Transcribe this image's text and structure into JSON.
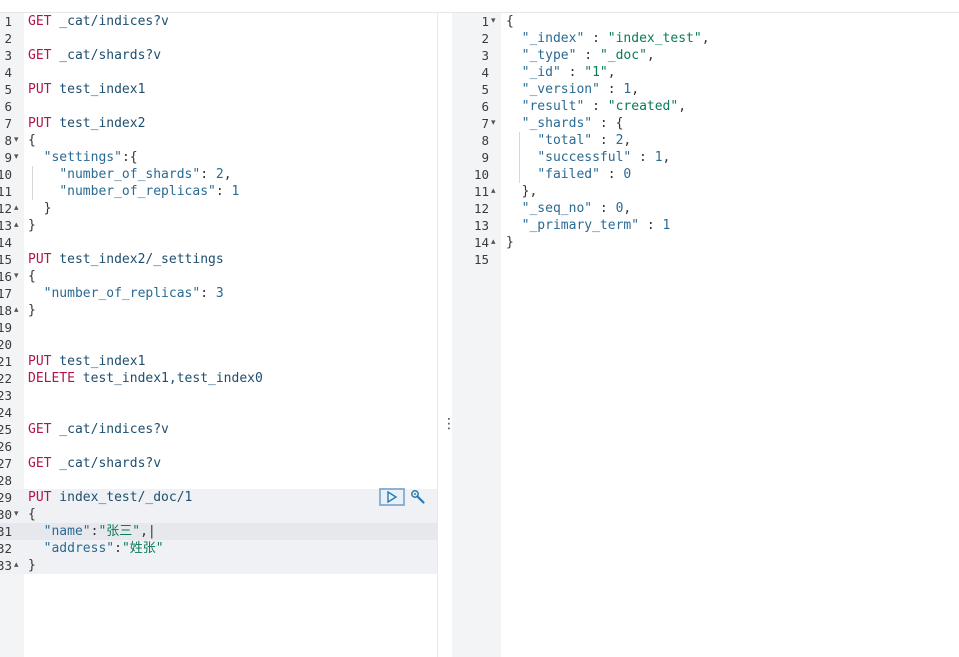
{
  "request": {
    "lines": [
      {
        "n": "1",
        "t": [
          [
            "m",
            "GET"
          ],
          [
            "u",
            " _cat/indices?v"
          ]
        ]
      },
      {
        "n": "2",
        "t": []
      },
      {
        "n": "3",
        "t": [
          [
            "m",
            "GET"
          ],
          [
            "u",
            " _cat/shards?v"
          ]
        ]
      },
      {
        "n": "4",
        "t": []
      },
      {
        "n": "5",
        "t": [
          [
            "m",
            "PUT"
          ],
          [
            "u",
            " test_index1"
          ]
        ]
      },
      {
        "n": "6",
        "t": []
      },
      {
        "n": "7",
        "t": [
          [
            "m",
            "PUT"
          ],
          [
            "u",
            " test_index2"
          ]
        ]
      },
      {
        "n": "8",
        "f": "▾",
        "t": [
          [
            "p",
            "{"
          ]
        ]
      },
      {
        "n": "9",
        "f": "▾",
        "t": [
          [
            "p",
            "  "
          ],
          [
            "k",
            "\"settings\""
          ],
          [
            "p",
            ":{"
          ]
        ]
      },
      {
        "n": "10",
        "t": [
          [
            "p",
            "    "
          ],
          [
            "k",
            "\"number_of_shards\""
          ],
          [
            "p",
            ": "
          ],
          [
            "n",
            "2"
          ],
          [
            "p",
            ","
          ]
        ]
      },
      {
        "n": "11",
        "t": [
          [
            "p",
            "    "
          ],
          [
            "k",
            "\"number_of_replicas\""
          ],
          [
            "p",
            ": "
          ],
          [
            "n",
            "1"
          ]
        ]
      },
      {
        "n": "12",
        "f": "▴",
        "t": [
          [
            "p",
            "  }"
          ]
        ]
      },
      {
        "n": "13",
        "f": "▴",
        "t": [
          [
            "p",
            "}"
          ]
        ]
      },
      {
        "n": "14",
        "t": []
      },
      {
        "n": "15",
        "t": [
          [
            "m",
            "PUT"
          ],
          [
            "u",
            " test_index2/_settings"
          ]
        ]
      },
      {
        "n": "16",
        "f": "▾",
        "t": [
          [
            "p",
            "{"
          ]
        ]
      },
      {
        "n": "17",
        "t": [
          [
            "p",
            "  "
          ],
          [
            "k",
            "\"number_of_replicas\""
          ],
          [
            "p",
            ": "
          ],
          [
            "n",
            "3"
          ]
        ]
      },
      {
        "n": "18",
        "f": "▴",
        "t": [
          [
            "p",
            "}"
          ]
        ]
      },
      {
        "n": "19",
        "t": []
      },
      {
        "n": "20",
        "t": []
      },
      {
        "n": "21",
        "t": [
          [
            "m",
            "PUT"
          ],
          [
            "u",
            " test_index1"
          ]
        ]
      },
      {
        "n": "22",
        "t": [
          [
            "m",
            "DELETE"
          ],
          [
            "u",
            " test_index1,test_index0"
          ]
        ]
      },
      {
        "n": "23",
        "t": []
      },
      {
        "n": "24",
        "t": []
      },
      {
        "n": "25",
        "t": [
          [
            "m",
            "GET"
          ],
          [
            "u",
            " _cat/indices?v"
          ]
        ]
      },
      {
        "n": "26",
        "t": []
      },
      {
        "n": "27",
        "t": [
          [
            "m",
            "GET"
          ],
          [
            "u",
            " _cat/shards?v"
          ]
        ]
      },
      {
        "n": "28",
        "t": []
      },
      {
        "n": "29",
        "sel": true,
        "t": [
          [
            "m",
            "PUT"
          ],
          [
            "u",
            " index_test/_doc/1"
          ]
        ]
      },
      {
        "n": "30",
        "f": "▾",
        "sel": true,
        "t": [
          [
            "p",
            "{"
          ]
        ]
      },
      {
        "n": "31",
        "sel": true,
        "cur": true,
        "t": [
          [
            "p",
            "  "
          ],
          [
            "k",
            "\"name\""
          ],
          [
            "p",
            ":"
          ],
          [
            "s",
            "\"张三\""
          ],
          [
            "p",
            ",|"
          ]
        ]
      },
      {
        "n": "32",
        "sel": true,
        "t": [
          [
            "p",
            "  "
          ],
          [
            "k",
            "\"address\""
          ],
          [
            "p",
            ":"
          ],
          [
            "s",
            "\"姓张\""
          ]
        ]
      },
      {
        "n": "33",
        "f": "▴",
        "sel": true,
        "t": [
          [
            "p",
            "}"
          ]
        ]
      }
    ]
  },
  "response": {
    "lines": [
      {
        "n": "1",
        "f": "▾",
        "t": [
          [
            "p",
            "{"
          ]
        ]
      },
      {
        "n": "2",
        "t": [
          [
            "p",
            "  "
          ],
          [
            "k",
            "\"_index\""
          ],
          [
            "p",
            " : "
          ],
          [
            "s",
            "\"index_test\""
          ],
          [
            "p",
            ","
          ]
        ]
      },
      {
        "n": "3",
        "t": [
          [
            "p",
            "  "
          ],
          [
            "k",
            "\"_type\""
          ],
          [
            "p",
            " : "
          ],
          [
            "s",
            "\"_doc\""
          ],
          [
            "p",
            ","
          ]
        ]
      },
      {
        "n": "4",
        "t": [
          [
            "p",
            "  "
          ],
          [
            "k",
            "\"_id\""
          ],
          [
            "p",
            " : "
          ],
          [
            "s",
            "\"1\""
          ],
          [
            "p",
            ","
          ]
        ]
      },
      {
        "n": "5",
        "t": [
          [
            "p",
            "  "
          ],
          [
            "k",
            "\"_version\""
          ],
          [
            "p",
            " : "
          ],
          [
            "n",
            "1"
          ],
          [
            "p",
            ","
          ]
        ]
      },
      {
        "n": "6",
        "t": [
          [
            "p",
            "  "
          ],
          [
            "k",
            "\"result\""
          ],
          [
            "p",
            " : "
          ],
          [
            "s",
            "\"created\""
          ],
          [
            "p",
            ","
          ]
        ]
      },
      {
        "n": "7",
        "f": "▾",
        "t": [
          [
            "p",
            "  "
          ],
          [
            "k",
            "\"_shards\""
          ],
          [
            "p",
            " : {"
          ]
        ]
      },
      {
        "n": "8",
        "t": [
          [
            "p",
            "    "
          ],
          [
            "k",
            "\"total\""
          ],
          [
            "p",
            " : "
          ],
          [
            "n",
            "2"
          ],
          [
            "p",
            ","
          ]
        ]
      },
      {
        "n": "9",
        "t": [
          [
            "p",
            "    "
          ],
          [
            "k",
            "\"successful\""
          ],
          [
            "p",
            " : "
          ],
          [
            "n",
            "1"
          ],
          [
            "p",
            ","
          ]
        ]
      },
      {
        "n": "10",
        "t": [
          [
            "p",
            "    "
          ],
          [
            "k",
            "\"failed\""
          ],
          [
            "p",
            " : "
          ],
          [
            "n",
            "0"
          ]
        ]
      },
      {
        "n": "11",
        "f": "▴",
        "t": [
          [
            "p",
            "  },"
          ]
        ]
      },
      {
        "n": "12",
        "t": [
          [
            "p",
            "  "
          ],
          [
            "k",
            "\"_seq_no\""
          ],
          [
            "p",
            " : "
          ],
          [
            "n",
            "0"
          ],
          [
            "p",
            ","
          ]
        ]
      },
      {
        "n": "13",
        "t": [
          [
            "p",
            "  "
          ],
          [
            "k",
            "\"_primary_term\""
          ],
          [
            "p",
            " : "
          ],
          [
            "n",
            "1"
          ]
        ]
      },
      {
        "n": "14",
        "f": "▴",
        "t": [
          [
            "p",
            "}"
          ]
        ]
      },
      {
        "n": "15",
        "t": []
      }
    ]
  },
  "divider": {
    "grip": "⋮"
  },
  "icons": {
    "run": "play-icon",
    "settings": "wrench-icon"
  },
  "colors": {
    "method": "#b3134d",
    "key": "#2a6a93",
    "string": "#0a7a5a",
    "selection": "#eff1f4"
  }
}
